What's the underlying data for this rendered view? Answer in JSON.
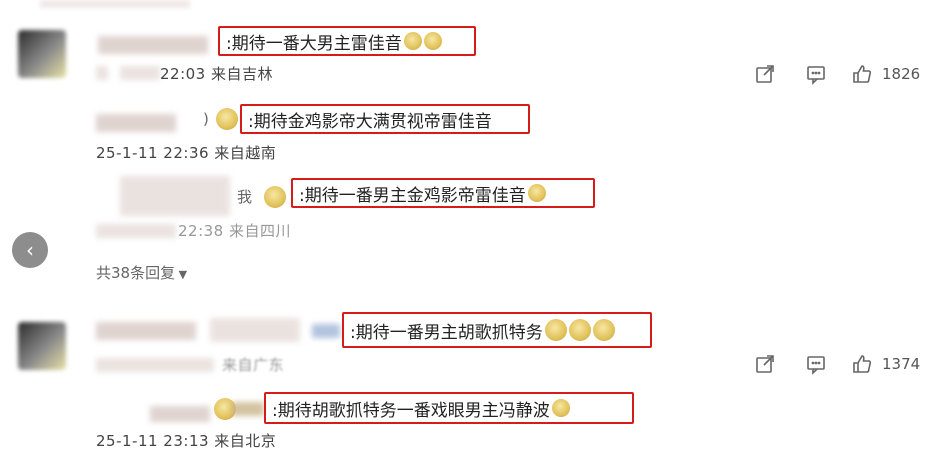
{
  "comments": [
    {
      "highlight_text": ":期待一番大男主雷佳音",
      "meta": "22:03 来自吉林",
      "like_count": "1826",
      "icons": [
        "share-icon",
        "comment-icon",
        "like-icon"
      ],
      "replies": [
        {
          "prefix": ")",
          "highlight_text": ":期待金鸡影帝大满贯视帝雷佳音",
          "meta": "25-1-11 22:36 来自越南"
        },
        {
          "prefix": "我",
          "highlight_text": ":期待一番男主金鸡影帝雷佳音",
          "meta": "22:38 来自四川"
        }
      ],
      "expand_label": "共38条回复"
    },
    {
      "highlight_text": ":期待一番男主胡歌抓特务",
      "meta": "来自广东",
      "like_count": "1374",
      "icons": [
        "share-icon",
        "comment-icon",
        "like-icon"
      ],
      "replies": [
        {
          "prefix": "",
          "highlight_text": ":期待胡歌抓特务一番戏眼男主冯静波",
          "meta": "25-1-11 23:13 来自北京"
        }
      ]
    }
  ],
  "nav": {
    "prev_label": "‹"
  },
  "colors": {
    "highlight_border": "#d61b1b",
    "nav_bg": "#8d8d8d"
  }
}
